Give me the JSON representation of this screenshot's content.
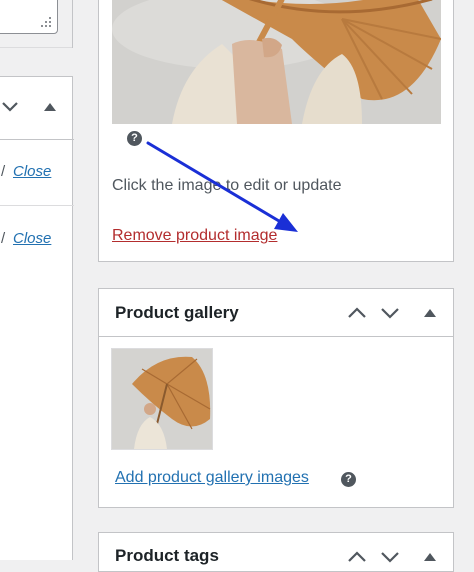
{
  "left_column": {
    "close_link_1": "Close",
    "close_link_2": "Close",
    "separator": "/"
  },
  "product_image_box": {
    "instruction_text": "Click the image to edit or update",
    "remove_link": "Remove product image"
  },
  "product_gallery_box": {
    "title": "Product gallery",
    "add_link": "Add product gallery images"
  },
  "product_tags_box": {
    "title": "Product tags"
  },
  "colors": {
    "link": "#2271b1",
    "remove_link": "#b32d2e",
    "annotation_arrow": "#1a2fd6",
    "help_icon": "#50575e"
  },
  "icons": [
    "help-icon",
    "chevron-up-icon",
    "chevron-down-icon",
    "triangle-up-icon",
    "resize-grip-icon",
    "annotation-arrow"
  ]
}
